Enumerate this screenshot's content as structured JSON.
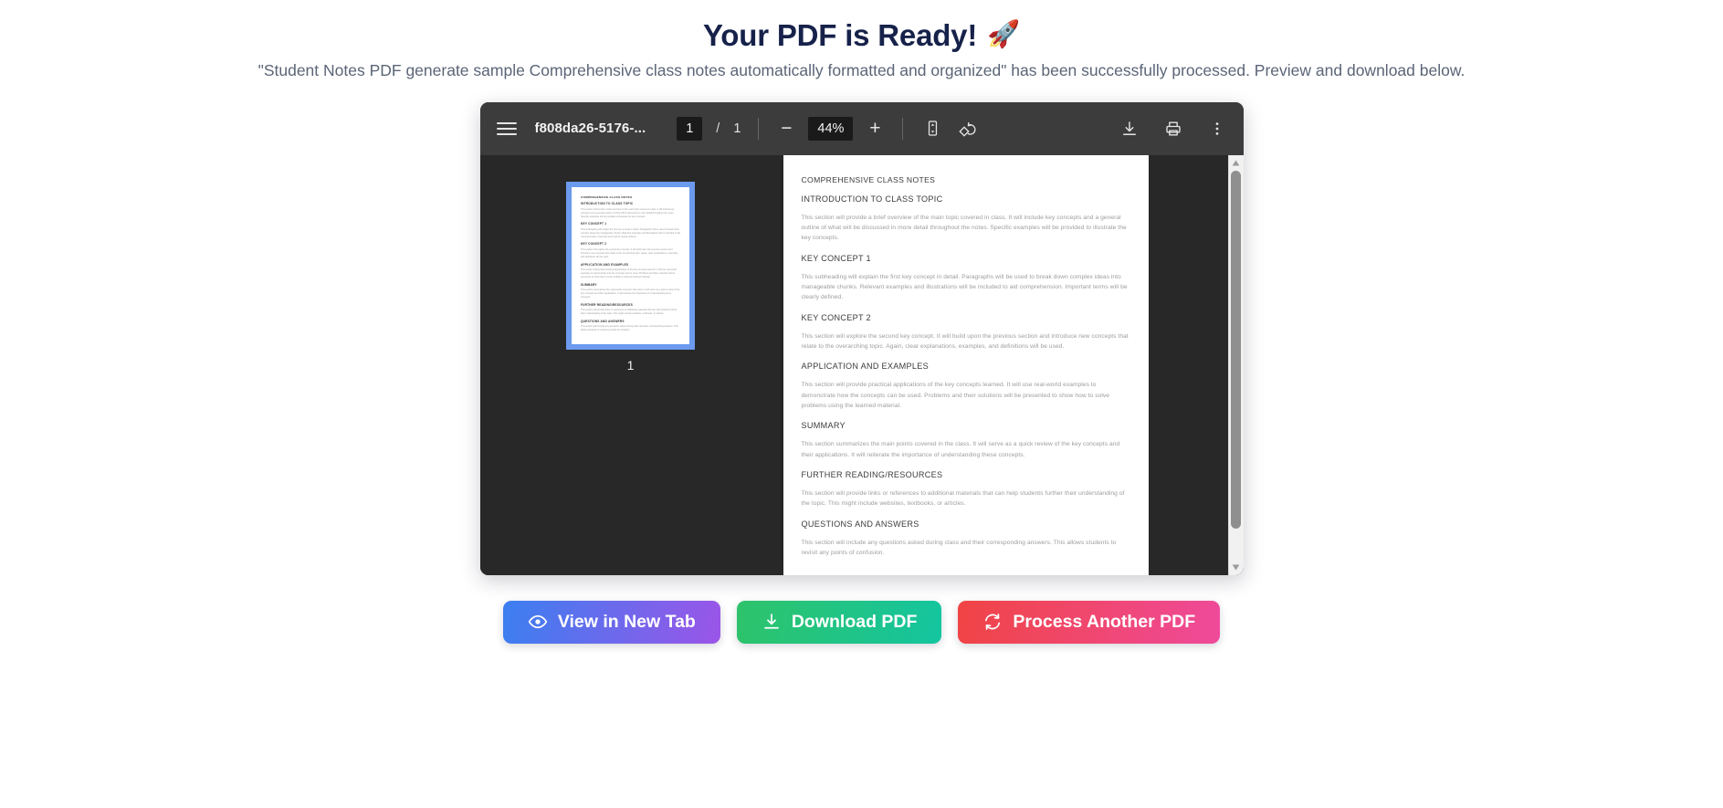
{
  "header": {
    "title": "Your PDF is Ready!",
    "rocket_icon": "rocket-emoji",
    "rocket_glyph": "🚀",
    "subtitle": "\"Student Notes PDF generate sample Comprehensive class notes automatically formatted and organized\" has been successfully processed. Preview and download below.",
    "title_color": "#17224a",
    "subtitle_color": "#5b6577"
  },
  "viewer": {
    "toolbar": {
      "menu_icon": "hamburger-menu-icon",
      "filename": "f808da26-5176-...",
      "current_page": "1",
      "page_separator": "/",
      "total_pages": "1",
      "zoom_out_label": "−",
      "zoom_level": "44%",
      "zoom_in_label": "+",
      "fit_page_icon": "fit-to-page-icon",
      "rotate_icon": "rotate-counterclockwise-icon",
      "download_icon": "download-icon",
      "print_icon": "print-icon",
      "more_icon": "more-vertical-icon",
      "background": "#3c3c3c"
    },
    "thumbnail_panel": {
      "page_label": "1",
      "selected": true,
      "selection_color": "#6b9aee",
      "background": "#282828"
    },
    "scrollbar": {
      "up_arrow_icon": "scroll-up-arrow-icon",
      "down_arrow_icon": "scroll-down-arrow-icon",
      "thumb_position": "top"
    },
    "document": {
      "blocks": [
        {
          "type": "h1",
          "text": "COMPREHENSIVE CLASS NOTES"
        },
        {
          "type": "h2",
          "text": "INTRODUCTION TO CLASS TOPIC"
        },
        {
          "type": "p",
          "text": "This section will provide a brief overview of the main topic covered in class.  It will include key concepts and a general outline of what will be discussed in more detail throughout the notes. Specific examples will be provided to illustrate the key concepts."
        },
        {
          "type": "h2",
          "text": "KEY CONCEPT 1"
        },
        {
          "type": "p",
          "text": "This subheading will explain the first key concept in detail.  Paragraphs will be used to break down complex ideas into manageable chunks. Relevant examples and illustrations will be included to aid comprehension.  Important terms will be clearly defined."
        },
        {
          "type": "h2",
          "text": "KEY CONCEPT 2"
        },
        {
          "type": "p",
          "text": "This section will explore the second key concept.  It will build upon the previous section and introduce new concepts that relate to the overarching topic. Again, clear explanations, examples, and definitions will be used."
        },
        {
          "type": "h2",
          "text": "APPLICATION AND EXAMPLES"
        },
        {
          "type": "p",
          "text": "This section will provide practical applications of the key concepts learned. It will use real-world examples to demonstrate how the concepts can be used.  Problems and their solutions will be presented to show how to solve problems using the learned material."
        },
        {
          "type": "h2",
          "text": "SUMMARY"
        },
        {
          "type": "p",
          "text": "This section summarizes the main points covered in the class.  It will serve as a quick review of the key concepts and their applications.  It will reiterate the importance of understanding these concepts."
        },
        {
          "type": "h2",
          "text": "FURTHER READING/RESOURCES"
        },
        {
          "type": "p",
          "text": "This section will provide links or references to additional materials that can help students further their understanding of the topic. This might include websites, textbooks, or articles."
        },
        {
          "type": "h2",
          "text": "QUESTIONS AND ANSWERS"
        },
        {
          "type": "p",
          "text": "This section will include any questions asked during class and their corresponding answers. This allows students to revisit any points of confusion."
        }
      ]
    }
  },
  "actions": [
    {
      "id": "view-new-tab",
      "label": "View in New Tab",
      "icon": "eye-icon",
      "gradient_from": "#3b7ff0",
      "gradient_to": "#9b55e8"
    },
    {
      "id": "download-pdf",
      "label": "Download PDF",
      "icon": "download-icon",
      "gradient_from": "#2ec36a",
      "gradient_to": "#14c59f"
    },
    {
      "id": "process-again",
      "label": "Process Another PDF",
      "icon": "refresh-icon",
      "gradient_from": "#f04444",
      "gradient_to": "#ef4a9b"
    }
  ]
}
